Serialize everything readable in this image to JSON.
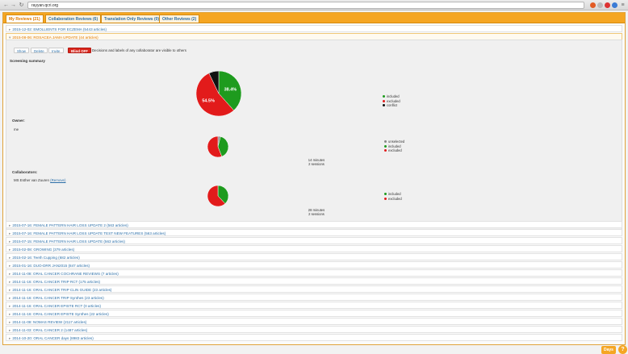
{
  "browser": {
    "url": "rayyan.qcri.org",
    "back_icon": "arrow-left",
    "forward_icon": "arrow-right",
    "reload_icon": "reload"
  },
  "tabs": [
    {
      "label": "My Reviews (21)",
      "active": true
    },
    {
      "label": "Collaboration Reviews (6)",
      "active": false
    },
    {
      "label": "Translation Only Reviews (0)",
      "active": false
    },
    {
      "label": "Other Reviews (2)",
      "active": false
    }
  ],
  "open_reviews": [
    "2015-12-02: EMOLLIENTS FOR ECZEMA (5443 articles)",
    "2015-08-06: ROSACEA JAMA UPDATE (44 articles)"
  ],
  "actions": {
    "show": "Show",
    "delete": "Delete",
    "invite": "Invite",
    "blind_toggle": "Blind OFF",
    "blind_note": "Decisions and labels of any collaborator are visible to others"
  },
  "screening_summary": {
    "heading": "Screening summary",
    "slices": [
      {
        "label": "included",
        "percent": 38.4,
        "color": "#1e9b1e",
        "shown_label": "38.4%"
      },
      {
        "label": "excluded",
        "percent": 54.5,
        "color": "#e21b1b",
        "shown_label": "54.5%"
      },
      {
        "label": "conflict",
        "percent": 7.1,
        "color": "#111111",
        "shown_label": ""
      }
    ]
  },
  "owner": {
    "heading": "Owner:",
    "name": "me",
    "slices": [
      {
        "label": "unselected",
        "percent": 4,
        "color": "#888888"
      },
      {
        "label": "included",
        "percent": 40,
        "color": "#1e9b1e"
      },
      {
        "label": "excluded",
        "percent": 56,
        "color": "#e21b1b"
      }
    ],
    "time": "14 minutes",
    "sessions": "2 sessions"
  },
  "collaborators": {
    "heading": "Collaborators:",
    "name": "MS Esther van Zuuren",
    "remove_label": "(Remove)",
    "slices": [
      {
        "label": "included",
        "percent": 38,
        "color": "#1e9b1e"
      },
      {
        "label": "excluded",
        "percent": 62,
        "color": "#e21b1b"
      }
    ],
    "time": "28 minutes",
    "sessions": "2 sessions"
  },
  "other_reviews": [
    "2015-07-16: FEMALE PATTERN HAIR LOSS UPDATE 2 (563 articles)",
    "2015-07-16: FEMALE PATTERN HAIR LOSS UPDATE TEST NEW FEATURES (563 articles)",
    "2015-07-15: FEMALE PATTERN HAIR LOSS UPDATE (563 articles)",
    "2015-02-08: GROWING (379 articles)",
    "2015-02-16: Teeth Cupping (682 articles)",
    "2015-01-16: DUO-DRR JAN2015 (847 articles)",
    "2014-11-08: ORAL CANCER COCHRANE REVIEWS (7 articles)",
    "2014-11-16: ORAL CANCER TRIP RCT (175 articles)",
    "2014-11-16: ORAL CANCER TRIP CLIN GUIDE (23 articles)",
    "2014-11-16: ORAL CANCER TRIP Synthes (23 articles)",
    "2014-11-16: ORAL CANCER EPISTE RCT (0 articles)",
    "2014-11-16: ORAL CANCER EPISTE Synthes (22 articles)",
    "2014-11-08: NOMAS REVIEW (2117 articles)",
    "2014-11-03: ORAL CANCER 2 (1487 articles)",
    "2014-10-20: ORAL CANCER days (8983 articles)"
  ],
  "footer": {
    "days_badge": "Days",
    "help_label": "?"
  }
}
